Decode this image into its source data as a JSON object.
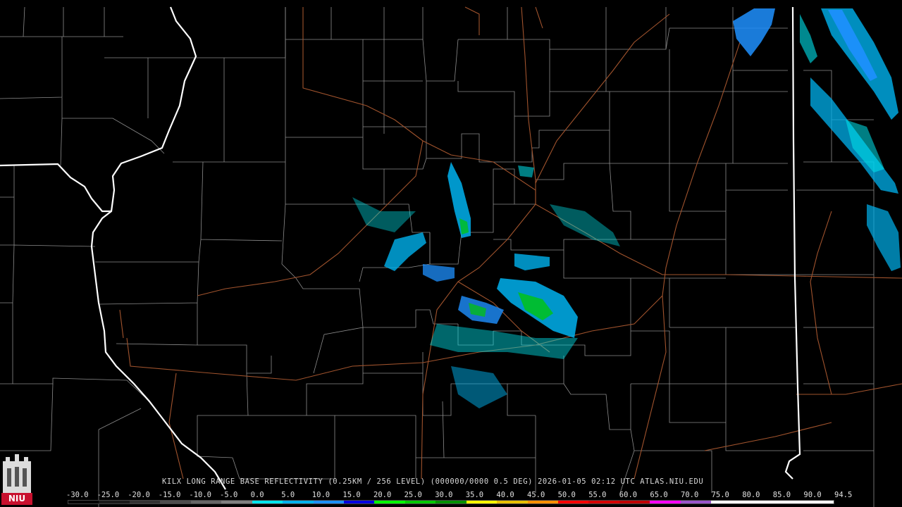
{
  "caption": "KILX LONG RANGE BASE REFLECTIVITY (0.25KM / 256 LEVEL) (000000/0000 0.5 DEG) 2026-01-05 02:12 UTC  ATLAS.NIU.EDU",
  "logo": {
    "text": "NIU",
    "color": "#c8102e"
  },
  "scale": {
    "labels": [
      "-30.0",
      "-25.0",
      "-20.0",
      "-15.0",
      "-10.0",
      "-5.0",
      "0.0",
      "5.0",
      "10.0",
      "15.0",
      "20.0",
      "25.0",
      "30.0",
      "35.0",
      "40.0",
      "45.0",
      "50.0",
      "55.0",
      "60.0",
      "65.0",
      "70.0",
      "75.0",
      "80.0",
      "85.0",
      "90.0",
      "94.5"
    ],
    "colors": [
      "#000000",
      "#1a1a1a",
      "#333333",
      "#4d4d4d",
      "#666666",
      "#808080",
      "#00e5ee",
      "#00b2ee",
      "#1e90ff",
      "#0000e0",
      "#00ff00",
      "#00c800",
      "#009000",
      "#ffff00",
      "#e7c000",
      "#ff9000",
      "#ff0000",
      "#d60000",
      "#c00000",
      "#ff00ff",
      "#9955c9",
      "#ffffff",
      "#ffffff",
      "#ffffff",
      "#ffffff"
    ]
  },
  "legend_colors": {
    "state_border": "#ffffff",
    "county_border": "#8c8c8c",
    "highway": "#a0532d",
    "background": "#000000"
  }
}
